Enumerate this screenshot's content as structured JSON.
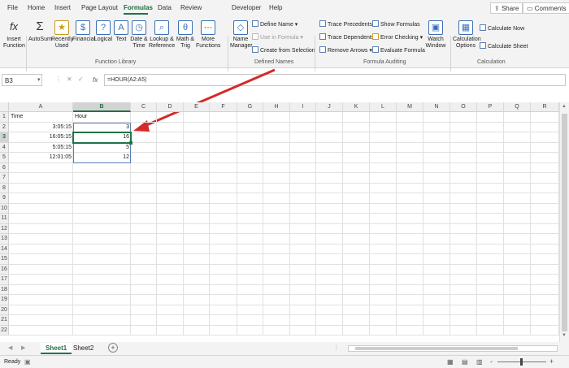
{
  "tabs": [
    "File",
    "Home",
    "Insert",
    "Page Layout",
    "Formulas",
    "Data",
    "Review",
    "Developer",
    "Help"
  ],
  "share_label": "Share",
  "comments_label": "Comments",
  "ribbon": {
    "insert_function": "Insert Function",
    "autosum": "AutoSum",
    "recently_used": "Recently Used",
    "financial": "Financial",
    "logical": "Logical",
    "text": "Text",
    "date_time": "Date & Time",
    "lookup": "Lookup & Reference",
    "math": "Math & Trig",
    "more": "More Functions",
    "function_library": "Function Library",
    "name_manager": "Name Manager",
    "define_name": "Define Name",
    "use_in_formula": "Use in Formula",
    "create_from_selection": "Create from Selection",
    "defined_names": "Defined Names",
    "trace_precedents": "Trace Precedents",
    "trace_dependents": "Trace Dependents",
    "remove_arrows": "Remove Arrows",
    "show_formulas": "Show Formulas",
    "error_checking": "Error Checking",
    "evaluate_formula": "Evaluate Formula",
    "formula_auditing": "Formula Auditing",
    "watch_window": "Watch Window",
    "calc_options": "Calculation Options",
    "calc_now": "Calculate Now",
    "calc_sheet": "Calculate Sheet",
    "calculation": "Calculation"
  },
  "name_box": "B3",
  "formula": "=HOUR(A2:A5)",
  "columns": [
    "A",
    "B",
    "C",
    "D",
    "E",
    "F",
    "G",
    "H",
    "I",
    "J",
    "K",
    "L",
    "M",
    "N",
    "O",
    "P",
    "Q",
    "R"
  ],
  "rows": [
    "1",
    "2",
    "3",
    "4",
    "5",
    "6",
    "7",
    "8",
    "9",
    "10",
    "11",
    "12",
    "13",
    "14",
    "15",
    "16",
    "17",
    "18",
    "19",
    "20",
    "21",
    "22"
  ],
  "cells": {
    "a1": "Time",
    "b1": "Hour",
    "a2": "3:05:15",
    "b2": "3",
    "a3": "16:05:15",
    "b3": "16",
    "a4": "5:05:15",
    "b4": "5",
    "a5": "12:01:05",
    "b5": "12"
  },
  "sheets": [
    "Sheet1",
    "Sheet2"
  ],
  "status": "Ready",
  "zoom": "+",
  "zoom_minus": "-",
  "accent": "#217346",
  "arrow_color": "#d42a2a"
}
